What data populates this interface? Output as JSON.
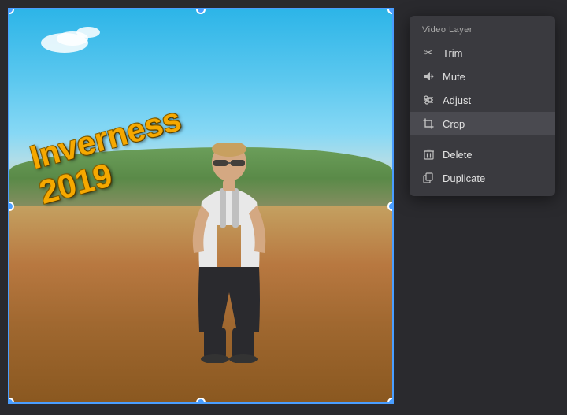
{
  "colors": {
    "background": "#2a2a2e",
    "accent": "#4a9eff",
    "menu_bg": "#3a3a3f",
    "menu_text": "#e0e0e0",
    "menu_label": "#aaaaaa",
    "highlight": "#4a4a50"
  },
  "menu": {
    "section_label": "Video Layer",
    "items": [
      {
        "id": "trim",
        "label": "Trim",
        "icon": "✂"
      },
      {
        "id": "mute",
        "label": "Mute",
        "icon": "🔇"
      },
      {
        "id": "adjust",
        "label": "Adjust",
        "icon": "⚙"
      },
      {
        "id": "crop",
        "label": "Crop",
        "icon": "⬜",
        "highlighted": true
      },
      {
        "id": "delete",
        "label": "Delete",
        "icon": "🗑"
      },
      {
        "id": "duplicate",
        "label": "Duplicate",
        "icon": "⧉"
      }
    ]
  },
  "text_overlay": {
    "line1": "Inverness",
    "line2": "2019"
  },
  "handles": [
    "tl",
    "tr",
    "bl",
    "br",
    "tc",
    "bc",
    "ml",
    "mr"
  ]
}
